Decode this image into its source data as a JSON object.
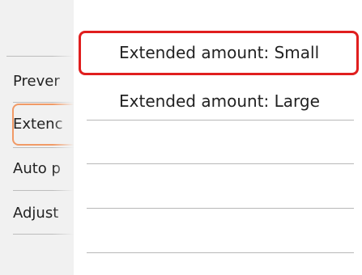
{
  "background_menu": {
    "items": [
      {
        "label": "Prever"
      },
      {
        "label": "Extenc"
      },
      {
        "label": "Auto p"
      },
      {
        "label": "Adjust"
      }
    ]
  },
  "popup": {
    "options": [
      {
        "label": "Extended amount: Small",
        "selected": true
      },
      {
        "label": "Extended amount: Large",
        "selected": false
      }
    ]
  },
  "colors": {
    "selection_border": "#e01e1e",
    "background_selection": "#f19a66"
  }
}
